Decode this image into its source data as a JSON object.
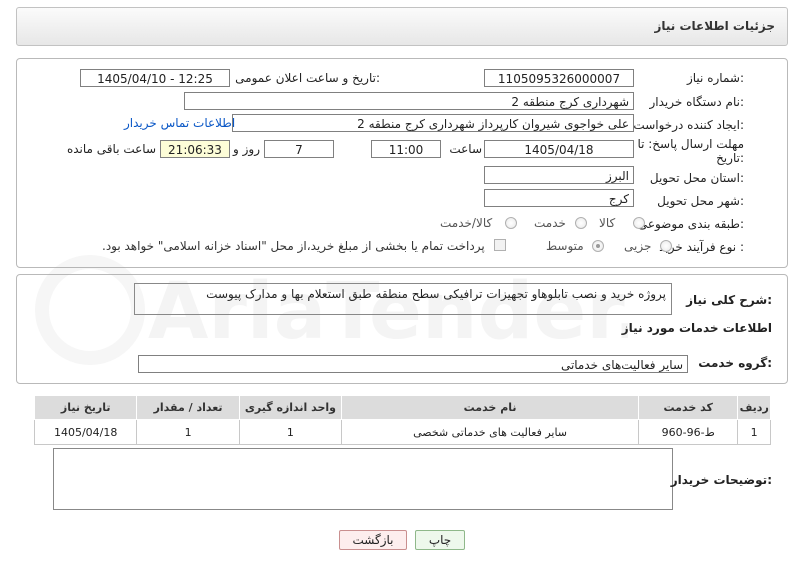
{
  "header": {
    "title": "جزئیات اطلاعات نیاز"
  },
  "fields": {
    "need_number_label": "شماره نیاز:",
    "need_number": "1105095326000007",
    "announce_label": "تاریخ و ساعت اعلان عمومی:",
    "announce_value": "1405/04/10 - 12:25",
    "buyer_org_label": "نام دستگاه خریدار:",
    "buyer_org": "شهرداری کرج منطقه 2",
    "requester_label": "ایجاد کننده درخواست:",
    "requester": "علی خواجوی شیروان کارپرداز شهرداری کرج منطقه 2",
    "contact_link": "اطلاعات تماس خریدار",
    "deadline_label_1": "مهلت ارسال پاسخ: تا",
    "deadline_label_2": "تاریخ:",
    "deadline_date": "1405/04/18",
    "time_label": "ساعت",
    "deadline_time": "11:00",
    "days_value": "7",
    "days_label": "روز و",
    "remaining_time": "21:06:33",
    "remaining_label": "ساعت باقی مانده",
    "province_label": "استان محل تحویل:",
    "province": "البرز",
    "city_label": "شهر محل تحویل:",
    "city": "کرج",
    "category_label": "طبقه بندی موضوعی:",
    "category_options": [
      "کالا",
      "خدمت",
      "کالا/خدمت"
    ],
    "process_label": "نوع فرآیند خرید :",
    "process_options": [
      "جزیی",
      "متوسط"
    ],
    "payment_note": "پرداخت تمام یا بخشی از مبلغ خرید،از محل \"اسناد خزانه اسلامی\" خواهد بود."
  },
  "description": {
    "label": "شرح کلی نیاز:",
    "text": "پروژه خرید و نصب تابلوهاو تجهیزات ترافیکی سطح منطقه طبق استعلام بها و مدارک پیوست"
  },
  "services": {
    "section_title": "اطلاعات خدمات مورد نیاز",
    "group_label": "گروه خدمت:",
    "group_value": "سایر فعالیت‌های خدماتی",
    "columns": [
      "ردیف",
      "کد خدمت",
      "نام خدمت",
      "واحد اندازه گیری",
      "تعداد / مقدار",
      "تاریخ نیاز"
    ],
    "rows": [
      {
        "idx": "1",
        "code": "ط-96-960",
        "name": "سایر فعالیت های خدماتی شخصی",
        "unit": "1",
        "qty": "1",
        "date": "1405/04/18"
      }
    ]
  },
  "buyer_notes": {
    "label": "توضیحات خریدار:"
  },
  "buttons": {
    "print": "چاپ",
    "back": "بازگشت"
  },
  "watermark": {
    "text": "AriaTender.net"
  }
}
